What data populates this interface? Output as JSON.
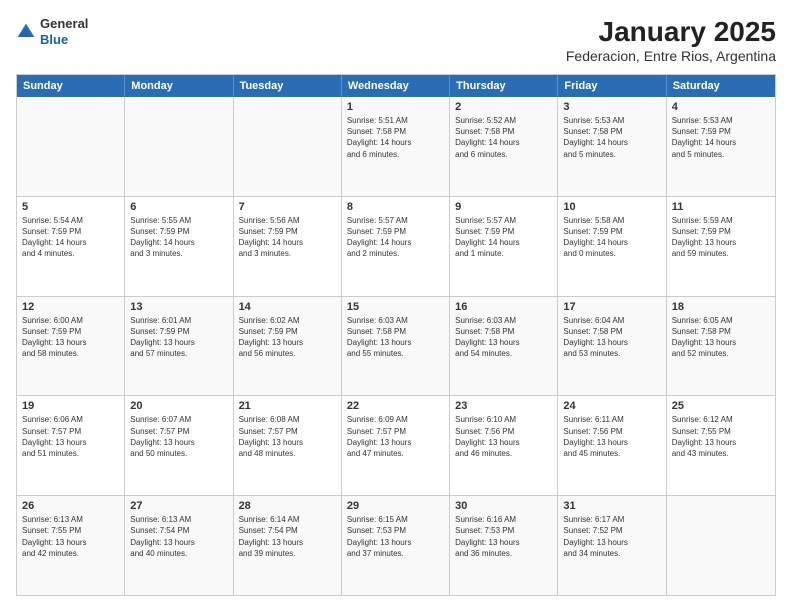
{
  "logo": {
    "general": "General",
    "blue": "Blue"
  },
  "title": "January 2025",
  "subtitle": "Federacion, Entre Rios, Argentina",
  "weekdays": [
    "Sunday",
    "Monday",
    "Tuesday",
    "Wednesday",
    "Thursday",
    "Friday",
    "Saturday"
  ],
  "rows": [
    [
      {
        "day": "",
        "info": ""
      },
      {
        "day": "",
        "info": ""
      },
      {
        "day": "",
        "info": ""
      },
      {
        "day": "1",
        "info": "Sunrise: 5:51 AM\nSunset: 7:58 PM\nDaylight: 14 hours\nand 6 minutes."
      },
      {
        "day": "2",
        "info": "Sunrise: 5:52 AM\nSunset: 7:58 PM\nDaylight: 14 hours\nand 6 minutes."
      },
      {
        "day": "3",
        "info": "Sunrise: 5:53 AM\nSunset: 7:58 PM\nDaylight: 14 hours\nand 5 minutes."
      },
      {
        "day": "4",
        "info": "Sunrise: 5:53 AM\nSunset: 7:59 PM\nDaylight: 14 hours\nand 5 minutes."
      }
    ],
    [
      {
        "day": "5",
        "info": "Sunrise: 5:54 AM\nSunset: 7:59 PM\nDaylight: 14 hours\nand 4 minutes."
      },
      {
        "day": "6",
        "info": "Sunrise: 5:55 AM\nSunset: 7:59 PM\nDaylight: 14 hours\nand 3 minutes."
      },
      {
        "day": "7",
        "info": "Sunrise: 5:56 AM\nSunset: 7:59 PM\nDaylight: 14 hours\nand 3 minutes."
      },
      {
        "day": "8",
        "info": "Sunrise: 5:57 AM\nSunset: 7:59 PM\nDaylight: 14 hours\nand 2 minutes."
      },
      {
        "day": "9",
        "info": "Sunrise: 5:57 AM\nSunset: 7:59 PM\nDaylight: 14 hours\nand 1 minute."
      },
      {
        "day": "10",
        "info": "Sunrise: 5:58 AM\nSunset: 7:59 PM\nDaylight: 14 hours\nand 0 minutes."
      },
      {
        "day": "11",
        "info": "Sunrise: 5:59 AM\nSunset: 7:59 PM\nDaylight: 13 hours\nand 59 minutes."
      }
    ],
    [
      {
        "day": "12",
        "info": "Sunrise: 6:00 AM\nSunset: 7:59 PM\nDaylight: 13 hours\nand 58 minutes."
      },
      {
        "day": "13",
        "info": "Sunrise: 6:01 AM\nSunset: 7:59 PM\nDaylight: 13 hours\nand 57 minutes."
      },
      {
        "day": "14",
        "info": "Sunrise: 6:02 AM\nSunset: 7:59 PM\nDaylight: 13 hours\nand 56 minutes."
      },
      {
        "day": "15",
        "info": "Sunrise: 6:03 AM\nSunset: 7:58 PM\nDaylight: 13 hours\nand 55 minutes."
      },
      {
        "day": "16",
        "info": "Sunrise: 6:03 AM\nSunset: 7:58 PM\nDaylight: 13 hours\nand 54 minutes."
      },
      {
        "day": "17",
        "info": "Sunrise: 6:04 AM\nSunset: 7:58 PM\nDaylight: 13 hours\nand 53 minutes."
      },
      {
        "day": "18",
        "info": "Sunrise: 6:05 AM\nSunset: 7:58 PM\nDaylight: 13 hours\nand 52 minutes."
      }
    ],
    [
      {
        "day": "19",
        "info": "Sunrise: 6:06 AM\nSunset: 7:57 PM\nDaylight: 13 hours\nand 51 minutes."
      },
      {
        "day": "20",
        "info": "Sunrise: 6:07 AM\nSunset: 7:57 PM\nDaylight: 13 hours\nand 50 minutes."
      },
      {
        "day": "21",
        "info": "Sunrise: 6:08 AM\nSunset: 7:57 PM\nDaylight: 13 hours\nand 48 minutes."
      },
      {
        "day": "22",
        "info": "Sunrise: 6:09 AM\nSunset: 7:57 PM\nDaylight: 13 hours\nand 47 minutes."
      },
      {
        "day": "23",
        "info": "Sunrise: 6:10 AM\nSunset: 7:56 PM\nDaylight: 13 hours\nand 46 minutes."
      },
      {
        "day": "24",
        "info": "Sunrise: 6:11 AM\nSunset: 7:56 PM\nDaylight: 13 hours\nand 45 minutes."
      },
      {
        "day": "25",
        "info": "Sunrise: 6:12 AM\nSunset: 7:55 PM\nDaylight: 13 hours\nand 43 minutes."
      }
    ],
    [
      {
        "day": "26",
        "info": "Sunrise: 6:13 AM\nSunset: 7:55 PM\nDaylight: 13 hours\nand 42 minutes."
      },
      {
        "day": "27",
        "info": "Sunrise: 6:13 AM\nSunset: 7:54 PM\nDaylight: 13 hours\nand 40 minutes."
      },
      {
        "day": "28",
        "info": "Sunrise: 6:14 AM\nSunset: 7:54 PM\nDaylight: 13 hours\nand 39 minutes."
      },
      {
        "day": "29",
        "info": "Sunrise: 6:15 AM\nSunset: 7:53 PM\nDaylight: 13 hours\nand 37 minutes."
      },
      {
        "day": "30",
        "info": "Sunrise: 6:16 AM\nSunset: 7:53 PM\nDaylight: 13 hours\nand 36 minutes."
      },
      {
        "day": "31",
        "info": "Sunrise: 6:17 AM\nSunset: 7:52 PM\nDaylight: 13 hours\nand 34 minutes."
      },
      {
        "day": "",
        "info": ""
      }
    ]
  ]
}
